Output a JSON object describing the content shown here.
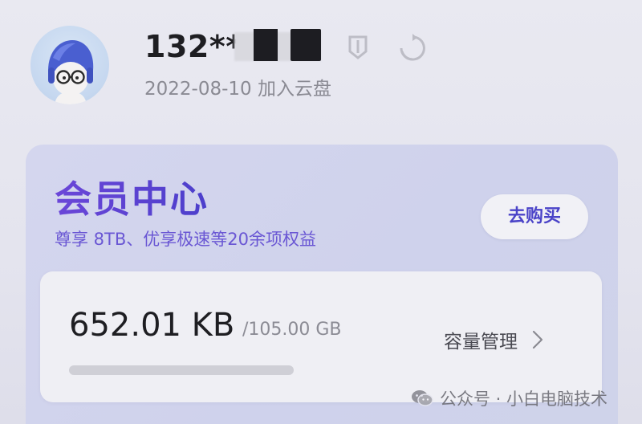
{
  "profile": {
    "username": "132**",
    "join_date": "2022-08-10 加入云盘",
    "avatar_icon": "avatar-cartoon-helmet-glasses-icon"
  },
  "vip": {
    "title": "会员中心",
    "subtitle": "尊享 8TB、优享极速等20余项权益",
    "buy_label": "去购买",
    "accent_color": "#5a3fd1"
  },
  "storage": {
    "used": "652.01 KB",
    "total": "/105.00 GB",
    "used_fraction": 6e-06,
    "manage_label": "容量管理",
    "chevron_icon": "chevron-right-icon",
    "bar_color": "#4b6cf0"
  },
  "watermark": {
    "icon": "wechat-icon",
    "text": "公众号 · 小白电脑技术"
  }
}
